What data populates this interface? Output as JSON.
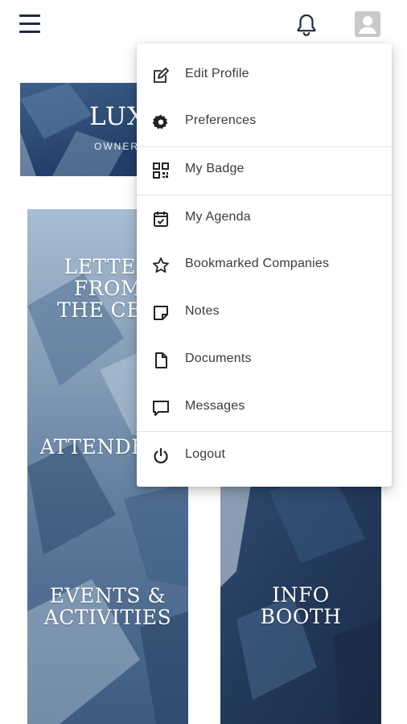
{
  "header": {
    "menu_icon": "hamburger-menu-icon",
    "notifications_icon": "bell-icon",
    "profile_icon": "avatar-icon"
  },
  "hero": {
    "title": "LUX",
    "subtitle": "OWNERS"
  },
  "tiles": {
    "letter": "LETTER\nFROM\nTHE CEO",
    "attendees": "ATTENDEES",
    "events": "EVENTS &\nACTIVITIES",
    "info": "INFO\nBOOTH"
  },
  "menu": {
    "items": [
      {
        "label": "Edit Profile",
        "icon": "edit-icon"
      },
      {
        "label": "Preferences",
        "icon": "gear-icon"
      },
      {
        "label": "My Badge",
        "icon": "qr-code-icon"
      },
      {
        "label": "My Agenda",
        "icon": "calendar-check-icon"
      },
      {
        "label": "Bookmarked Companies",
        "icon": "star-icon"
      },
      {
        "label": "Notes",
        "icon": "note-icon"
      },
      {
        "label": "Documents",
        "icon": "document-icon"
      },
      {
        "label": "Messages",
        "icon": "message-icon"
      },
      {
        "label": "Logout",
        "icon": "power-icon"
      }
    ]
  },
  "colors": {
    "navy": "#1e2a44",
    "menu_text": "#3b3b3b",
    "divider": "#e2e2e2",
    "tile_dark": "#2b4466",
    "tile_light": "#9fb3c9"
  }
}
